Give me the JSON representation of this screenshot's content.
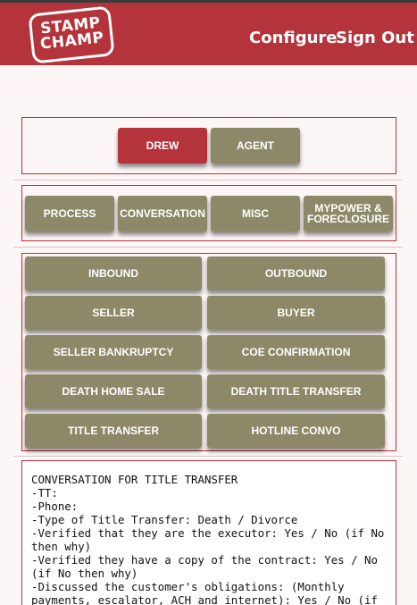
{
  "header": {
    "logo_line1": "STAMP",
    "logo_line2": "CHAMP",
    "nav": {
      "configure": "Configure",
      "sign_out": "Sign Out"
    }
  },
  "user_tabs": {
    "drew": "DREW",
    "agent": "AGENT",
    "selected": "DREW"
  },
  "category_tabs": {
    "process": "PROCESS",
    "conversation": "CONVERSATION",
    "misc": "MISC",
    "mypower": "MYPOWER & FORECLOSURE"
  },
  "templates": {
    "inbound": "INBOUND",
    "outbound": "OUTBOUND",
    "seller": "SELLER",
    "buyer": "BUYER",
    "seller_bankruptcy": "SELLER BANKRUPTCY",
    "coe_confirmation": "COE CONFIRMATION",
    "death_home_sale": "DEATH HOME SALE",
    "death_title_transfer": "DEATH TITLE TRANSFER",
    "title_transfer": "TITLE TRANSFER",
    "hotline_convo": "HOTLINE CONVO"
  },
  "notes": {
    "text": "CONVERSATION FOR TITLE TRANSFER\n-TT:\n-Phone:\n-Type of Title Transfer: Death / Divorce\n-Verified that they are the executor: Yes / No (if No then why)\n-Verified they have a copy of the contract: Yes / No (if No then why)\n-Discussed the customer's obligations: (Monthly payments, escalator, ACH and internet): Yes / No (if"
  },
  "colors": {
    "brand": "#b5333a",
    "button": "#8d8968",
    "background": "#fdf6f6"
  }
}
